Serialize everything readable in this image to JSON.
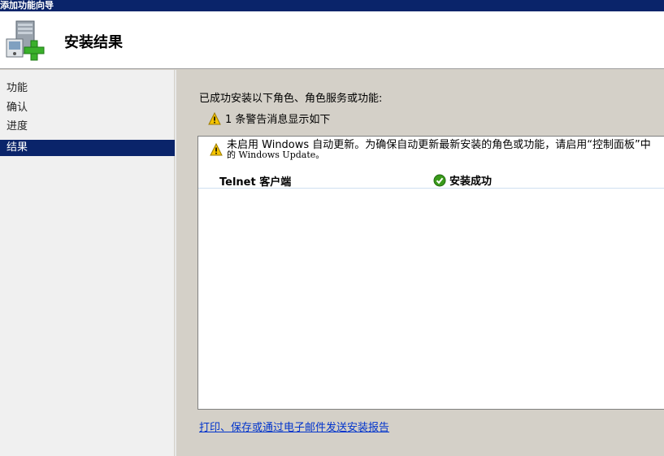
{
  "window": {
    "title": "添加功能向导"
  },
  "header": {
    "title": "安装结果",
    "icon": "server-add-icon"
  },
  "sidebar": {
    "items": [
      {
        "label": "功能",
        "active": false
      },
      {
        "label": "确认",
        "active": false
      },
      {
        "label": "进度",
        "active": false
      },
      {
        "label": "结果",
        "active": true
      }
    ]
  },
  "content": {
    "intro": "已成功安装以下角色、角色服务或功能:",
    "warning_summary": "1 条警告消息显示如下",
    "results": {
      "warning_line1": "未启用 Windows 自动更新。为确保自动更新最新安装的角色或功能，请启用“控制面板”中",
      "warning_line2": "的 Windows Update。",
      "feature_name": "Telnet 客户端",
      "feature_status": "安装成功"
    },
    "report_link": "打印、保存或通过电子邮件发送安装报告"
  },
  "colors": {
    "titlebar": "#0a246a",
    "selected": "#0a246a",
    "link": "#0033cc",
    "success": "#3a9a1a",
    "warning": "#f5c400"
  }
}
